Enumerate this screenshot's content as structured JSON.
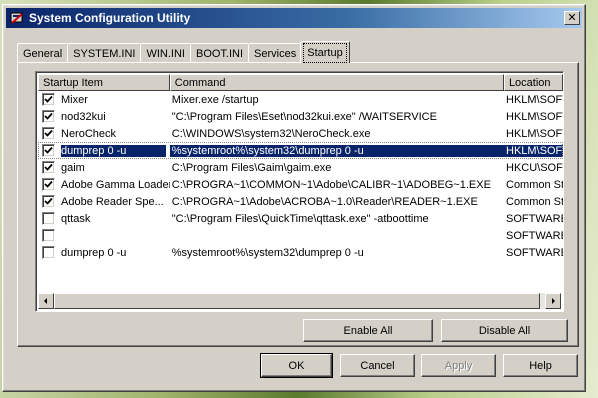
{
  "window": {
    "title": "System Configuration Utility",
    "icon": "system-config-icon",
    "close_label": "✕"
  },
  "tabs": [
    {
      "label": "General",
      "active": false
    },
    {
      "label": "SYSTEM.INI",
      "active": false
    },
    {
      "label": "WIN.INI",
      "active": false
    },
    {
      "label": "BOOT.INI",
      "active": false
    },
    {
      "label": "Services",
      "active": false
    },
    {
      "label": "Startup",
      "active": true
    }
  ],
  "list": {
    "columns": [
      "Startup Item",
      "Command",
      "Location"
    ],
    "rows": [
      {
        "checked": true,
        "item": "Mixer",
        "command": "Mixer.exe /startup",
        "location": "HKLM\\SOFTWARE"
      },
      {
        "checked": true,
        "item": "nod32kui",
        "command": "\"C:\\Program Files\\Eset\\nod32kui.exe\" /WAITSERVICE",
        "location": "HKLM\\SOFTWARE"
      },
      {
        "checked": true,
        "item": "NeroCheck",
        "command": "C:\\WINDOWS\\system32\\NeroCheck.exe",
        "location": "HKLM\\SOFTWARE"
      },
      {
        "checked": true,
        "item": "dumprep 0 -u",
        "command": "%systemroot%\\system32\\dumprep 0 -u",
        "location": "HKLM\\SOFTWARE",
        "selected": true
      },
      {
        "checked": true,
        "item": "gaim",
        "command": "C:\\Program Files\\Gaim\\gaim.exe",
        "location": "HKCU\\SOFTWARE"
      },
      {
        "checked": true,
        "item": "Adobe Gamma Loader",
        "command": "C:\\PROGRA~1\\COMMON~1\\Adobe\\CALIBR~1\\ADOBEG~1.EXE",
        "location": "Common Startup"
      },
      {
        "checked": true,
        "item": "Adobe Reader Spe...",
        "command": "C:\\PROGRA~1\\Adobe\\ACROBA~1.0\\Reader\\READER~1.EXE",
        "location": "Common Startup"
      },
      {
        "checked": false,
        "item": "qttask",
        "command": "\"C:\\Program Files\\QuickTime\\qttask.exe\" -atboottime",
        "location": "SOFTWARE"
      },
      {
        "checked": false,
        "item": "",
        "command": "",
        "location": "SOFTWARE"
      },
      {
        "checked": false,
        "item": "dumprep 0 -u",
        "command": "%systemroot%\\system32\\dumprep 0 -u",
        "location": "SOFTWARE"
      }
    ]
  },
  "scrollbar": {
    "left_icon": "arrow-left-icon",
    "right_icon": "arrow-right-icon"
  },
  "buttons": {
    "enable_all": "Enable All",
    "disable_all": "Disable All",
    "ok": "OK",
    "cancel": "Cancel",
    "apply": "Apply",
    "help": "Help"
  },
  "colors": {
    "selection": "#0a246a",
    "titlebar": "#0a246a",
    "face": "#d4d0c8"
  }
}
